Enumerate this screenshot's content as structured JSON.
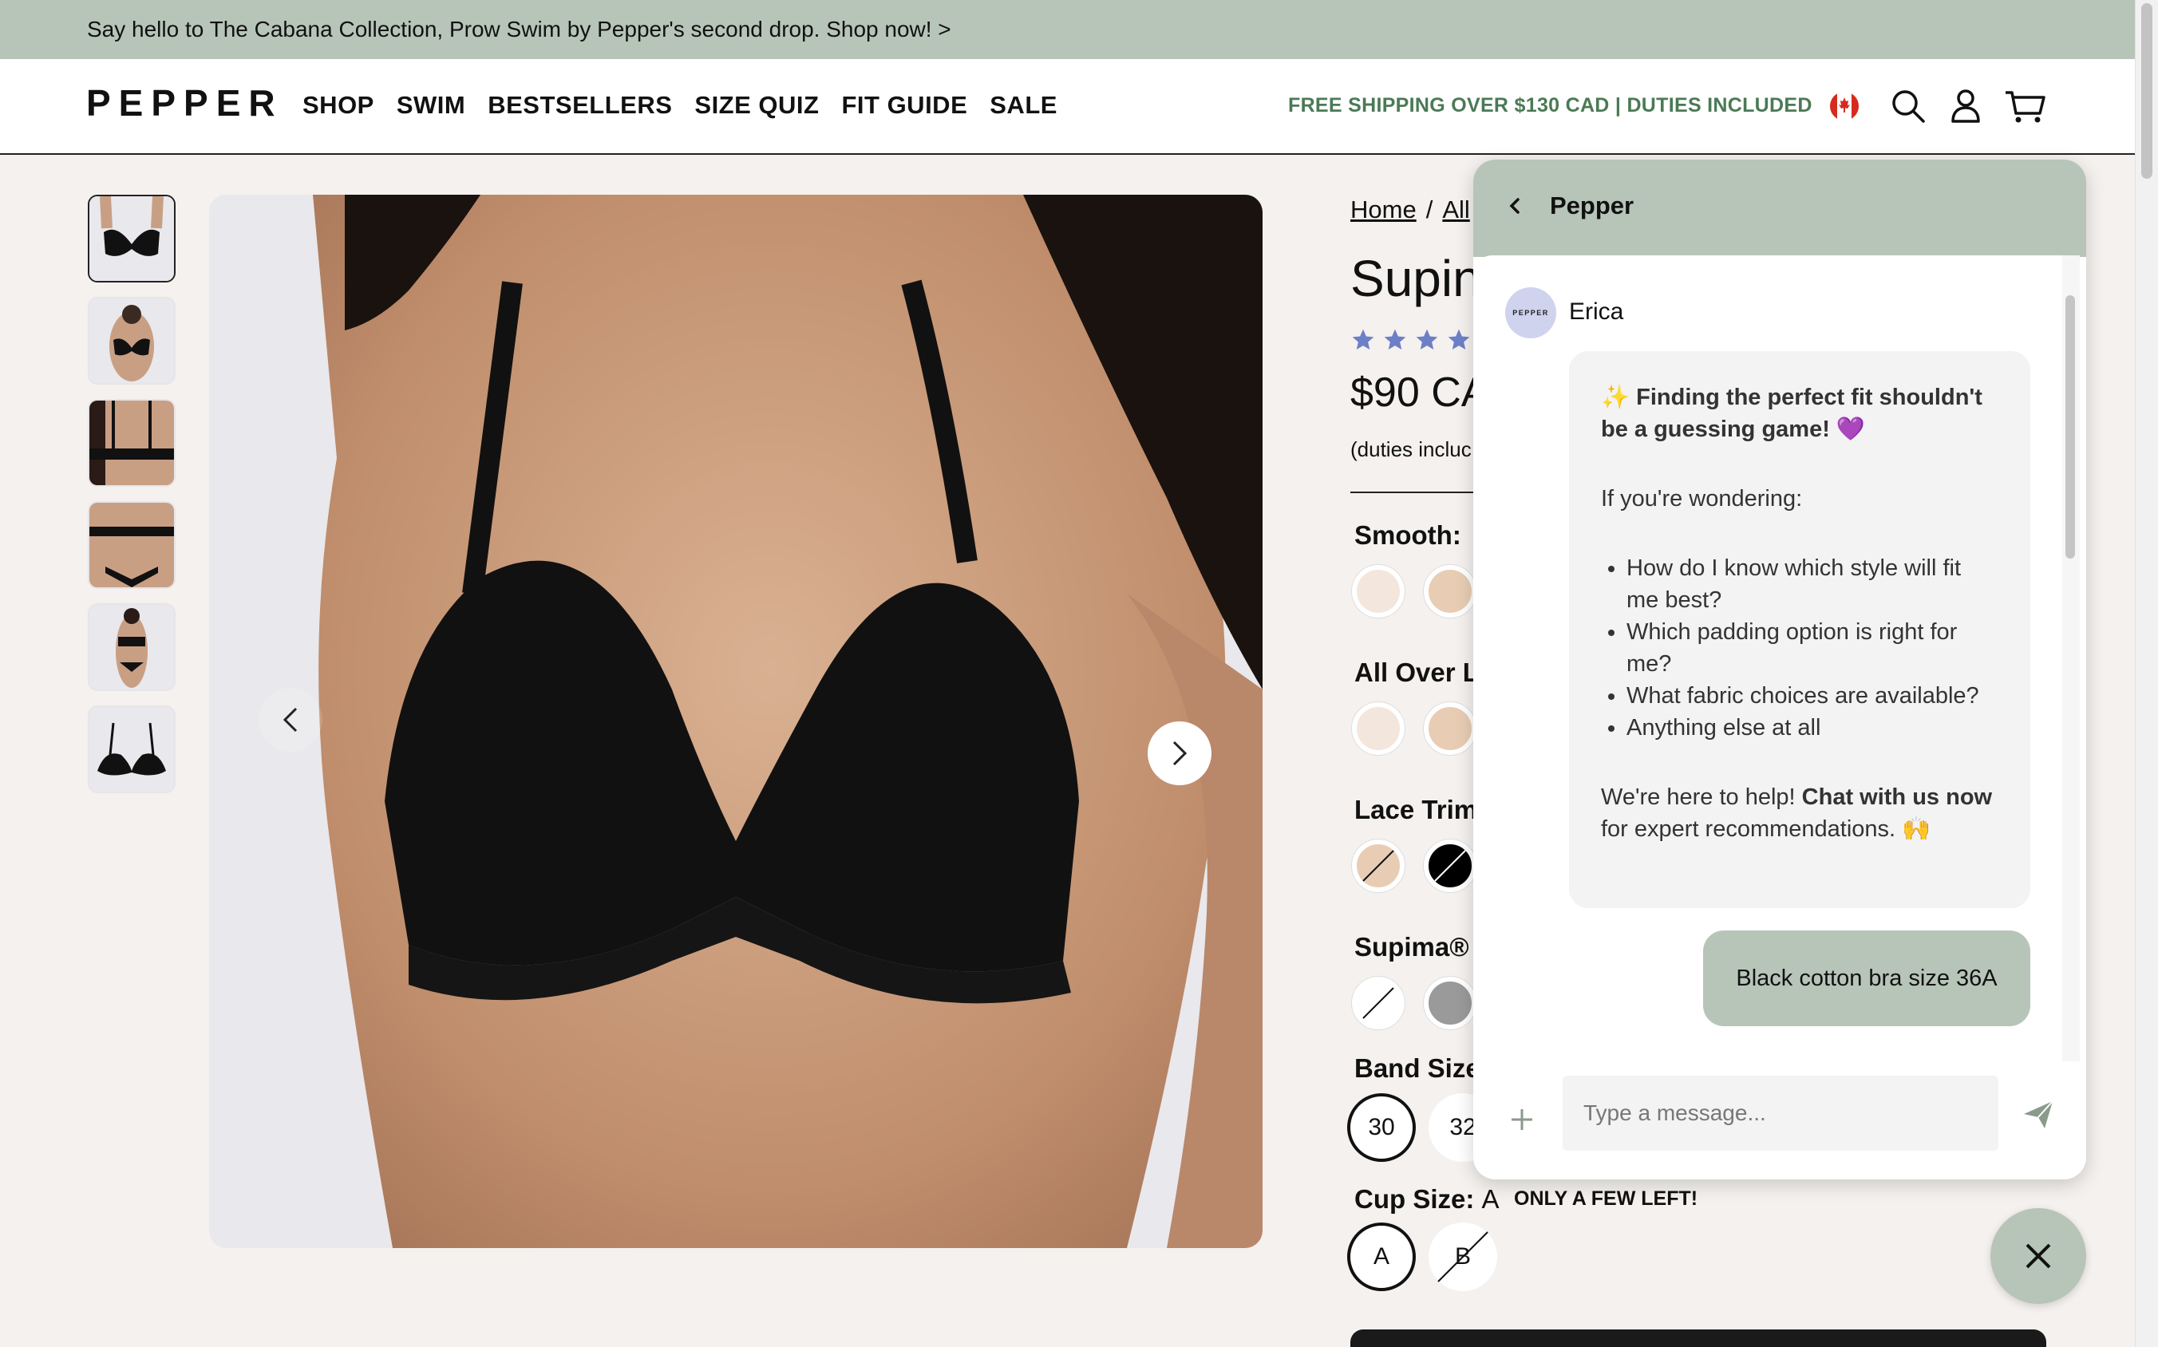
{
  "announcement": "Say hello to The Cabana Collection, Prow Swim by Pepper's second drop. Shop now! >",
  "header": {
    "logo": "PEPPER",
    "nav": [
      "SHOP",
      "SWIM",
      "BESTSELLERS",
      "SIZE QUIZ",
      "FIT GUIDE",
      "SALE"
    ],
    "shipping": "FREE SHIPPING OVER $130 CAD | DUTIES INCLUDED",
    "icons": [
      "canada-flag-icon",
      "search-icon",
      "account-icon",
      "cart-icon"
    ]
  },
  "gallery": {
    "thumbnails": [
      "thumbnail-1",
      "thumbnail-2",
      "thumbnail-3",
      "thumbnail-4",
      "thumbnail-5",
      "thumbnail-6"
    ],
    "active_index": 0
  },
  "product": {
    "breadcrumb": [
      "Home",
      "/",
      "All"
    ],
    "title": "Supin",
    "rating_stars": 5,
    "price": "$90 CA",
    "duties_note": "(duties incluc",
    "groups": {
      "smooth": "Smooth:",
      "all_over": "All Over L",
      "lace_trim": "Lace Trim",
      "supima": "Supima® C"
    },
    "band_size_label": "Band Size",
    "band_sizes": [
      "30",
      "32"
    ],
    "cup_size_label": "Cup Size:",
    "cup_size_value": "A",
    "cup_sizes": [
      "A",
      "B"
    ],
    "low_stock": "ONLY A FEW LEFT!"
  },
  "colors": {
    "accent_green": "#b7c5b8",
    "shipping_green": "#4a7a55",
    "star_blue": "#6d7fc7"
  },
  "chat": {
    "title": "Pepper",
    "agent_name": "Erica",
    "agent_avatar_text": "PEPPER",
    "headline": "✨ Finding the perfect fit shouldn't be a guessing game! 💜",
    "intro": "If you're wondering:",
    "bullets": [
      "How do I know which style will fit me best?",
      "Which padding option is right for me?",
      "What fabric choices are available?",
      "Anything else at all"
    ],
    "cta_prefix": "We're here to help!",
    "cta_bold": "Chat with us now",
    "cta_suffix": "for expert recommendations. 🙌",
    "user_message": "Black cotton bra size 36A",
    "input_placeholder": "Type a message..."
  }
}
